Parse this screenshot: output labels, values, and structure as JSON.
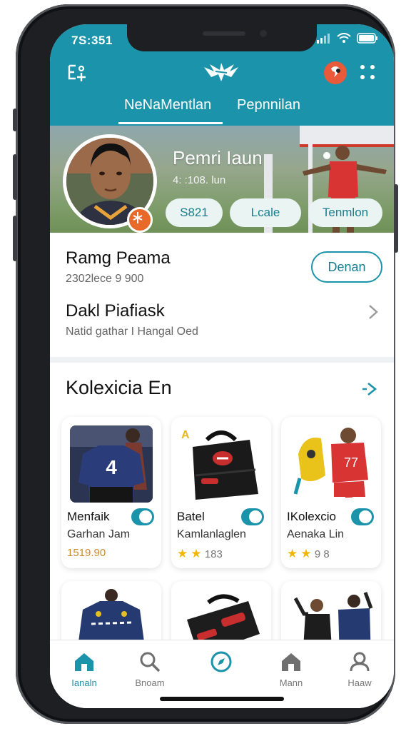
{
  "status": {
    "time": "7S:351"
  },
  "header": {
    "tabs": [
      {
        "label": "NeNaMentlan",
        "active": true
      },
      {
        "label": "Pepnnilan",
        "active": false
      }
    ]
  },
  "banner": {
    "name": "Pemri Iaun",
    "subtitle": "4: :108. lun",
    "pills": [
      {
        "label": "S821"
      },
      {
        "label": "Lcale"
      },
      {
        "label": "Tenmlon"
      }
    ]
  },
  "info": {
    "name": "Ramg Peama",
    "sub": "2302lece 9 900",
    "button_label": "Denan",
    "row2_title": "Dakl Piafiask",
    "row2_sub": "Natid gathar I Hangal Oed"
  },
  "collection": {
    "title": "Kolexicia En",
    "cards": [
      {
        "title": "Menfaik",
        "sub": "Garhan Jam",
        "price": "1519.90"
      },
      {
        "title": "Batel",
        "sub": "Kamlanlaglen",
        "rating": "183"
      },
      {
        "title": "IKolexcio",
        "sub": "Aenaka Lin",
        "rating": "9 8"
      }
    ]
  },
  "bottom_nav": [
    {
      "label": "Ianaln",
      "icon": "home-icon",
      "active": true
    },
    {
      "label": "Bnoam",
      "icon": "search-icon",
      "active": false
    },
    {
      "label": "",
      "icon": "compass-icon",
      "active": false
    },
    {
      "label": "Mann",
      "icon": "shop-icon",
      "active": false
    },
    {
      "label": "Haaw",
      "icon": "profile-icon",
      "active": false
    }
  ],
  "colors": {
    "accent": "#1b93aa",
    "white": "#ffffff"
  }
}
